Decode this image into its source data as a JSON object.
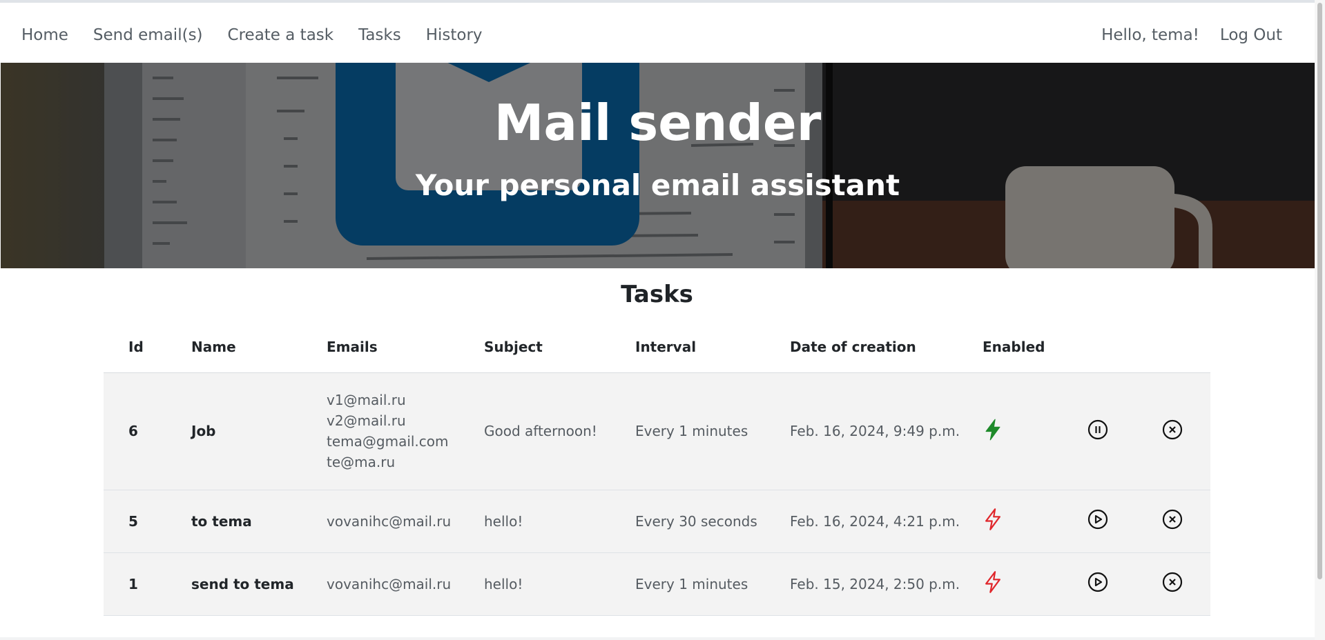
{
  "nav": {
    "left": [
      {
        "label": "Home"
      },
      {
        "label": "Send email(s)"
      },
      {
        "label": "Create a task"
      },
      {
        "label": "Tasks"
      },
      {
        "label": "History"
      }
    ],
    "greeting": "Hello, tema!",
    "logout": "Log Out"
  },
  "hero": {
    "title": "Mail sender",
    "subtitle": "Your personal email assistant"
  },
  "section_title": "Tasks",
  "table": {
    "headers": {
      "id": "Id",
      "name": "Name",
      "emails": "Emails",
      "subject": "Subject",
      "interval": "Interval",
      "date": "Date of creation",
      "enabled": "Enabled"
    },
    "rows": [
      {
        "id": "6",
        "name": "Job",
        "emails": [
          "v1@mail.ru",
          "v2@mail.ru",
          "tema@gmail.com",
          "te@ma.ru"
        ],
        "subject": "Good afternoon!",
        "interval": "Every 1 minutes",
        "date": "Feb. 16, 2024, 9:49 p.m.",
        "enabled": true,
        "action_icon": "pause-icon"
      },
      {
        "id": "5",
        "name": "to tema",
        "emails": [
          "vovanihc@mail.ru"
        ],
        "subject": "hello!",
        "interval": "Every 30 seconds",
        "date": "Feb. 16, 2024, 4:21 p.m.",
        "enabled": false,
        "action_icon": "play-icon"
      },
      {
        "id": "1",
        "name": "send to tema",
        "emails": [
          "vovanihc@mail.ru"
        ],
        "subject": "hello!",
        "interval": "Every 1 minutes",
        "date": "Feb. 15, 2024, 2:50 p.m.",
        "enabled": false,
        "action_icon": "play-icon"
      }
    ]
  },
  "colors": {
    "enabled_bolt": "#1e8a2a",
    "disabled_bolt": "#e0262b"
  }
}
